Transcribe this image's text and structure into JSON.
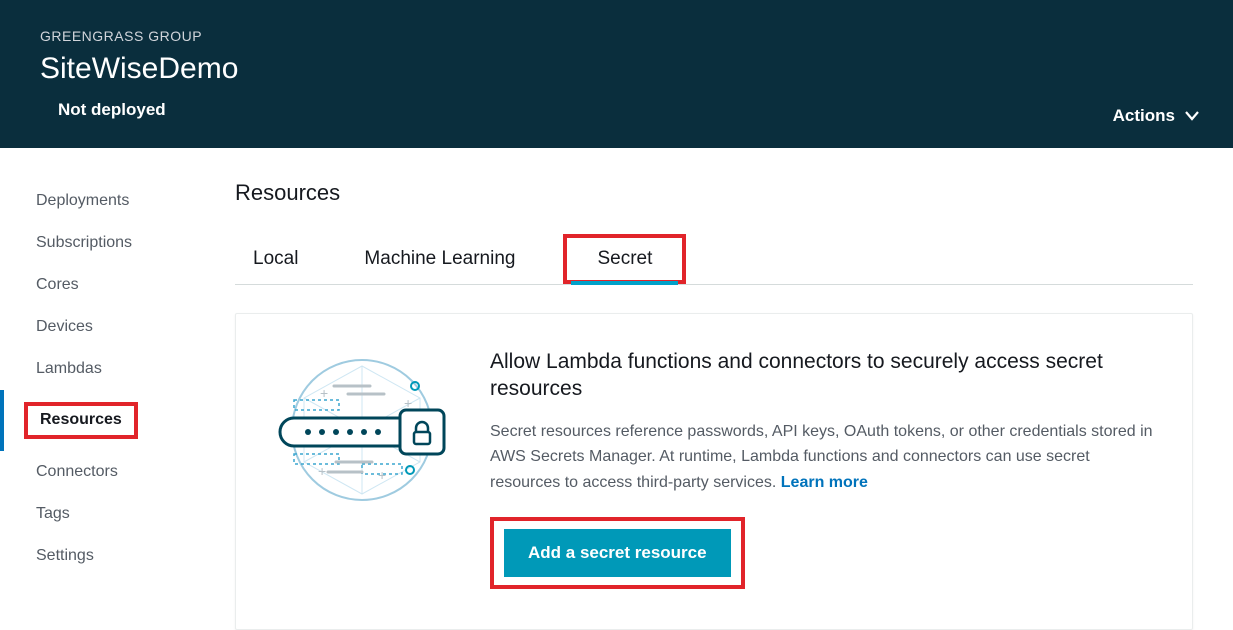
{
  "header": {
    "eyebrow": "GREENGRASS GROUP",
    "title": "SiteWiseDemo",
    "status": "Not deployed",
    "actions_label": "Actions"
  },
  "sidebar": {
    "items": [
      {
        "label": "Deployments"
      },
      {
        "label": "Subscriptions"
      },
      {
        "label": "Cores"
      },
      {
        "label": "Devices"
      },
      {
        "label": "Lambdas"
      },
      {
        "label": "Resources"
      },
      {
        "label": "Connectors"
      },
      {
        "label": "Tags"
      },
      {
        "label": "Settings"
      }
    ]
  },
  "main": {
    "page_title": "Resources",
    "tabs": {
      "local": "Local",
      "machine_learning": "Machine Learning",
      "secret": "Secret"
    },
    "panel": {
      "heading": "Allow Lambda functions and connectors to securely access secret resources",
      "description": "Secret resources reference passwords, API keys, OAuth tokens, or other credentials stored in AWS Secrets Manager. At runtime, Lambda functions and connectors can use secret resources to access third-party services. ",
      "learn_more_label": "Learn more",
      "add_button_label": "Add a secret resource"
    }
  }
}
